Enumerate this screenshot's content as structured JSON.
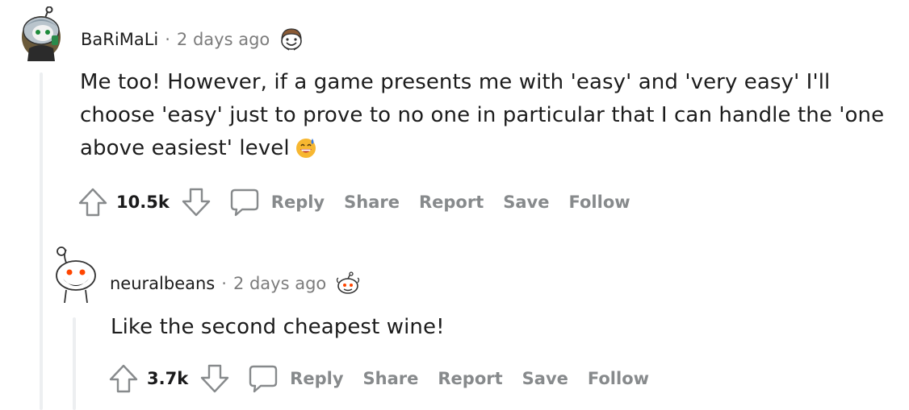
{
  "comments": [
    {
      "username": "BaRiMaLi",
      "separator": "·",
      "time": "2 days ago",
      "avatar_icon": "snoo-avatar-girl-icon",
      "flair_icon": "snoo-face-flair-icon",
      "body": "Me too! However, if a game presents me with 'easy' and 'very easy' I'll choose 'easy' just to prove to no one in particular that I can handle the 'one above easiest' level",
      "emoji": "grinning-sweat-emoji",
      "score": "10.5k",
      "actions": {
        "reply": "Reply",
        "share": "Share",
        "report": "Report",
        "save": "Save",
        "follow": "Follow"
      }
    },
    {
      "username": "neuralbeans",
      "separator": "·",
      "time": "2 days ago",
      "avatar_icon": "snoo-avatar-beard-icon",
      "flair_icon": "snoo-small-flair-icon",
      "body": "Like the second cheapest wine!",
      "score": "3.7k",
      "actions": {
        "reply": "Reply",
        "share": "Share",
        "report": "Report",
        "save": "Save",
        "follow": "Follow"
      }
    }
  ],
  "colors": {
    "text": "#1c1c1c",
    "muted": "#7c7c7c",
    "action": "#878a8c",
    "thread_line": "#edeff1"
  }
}
